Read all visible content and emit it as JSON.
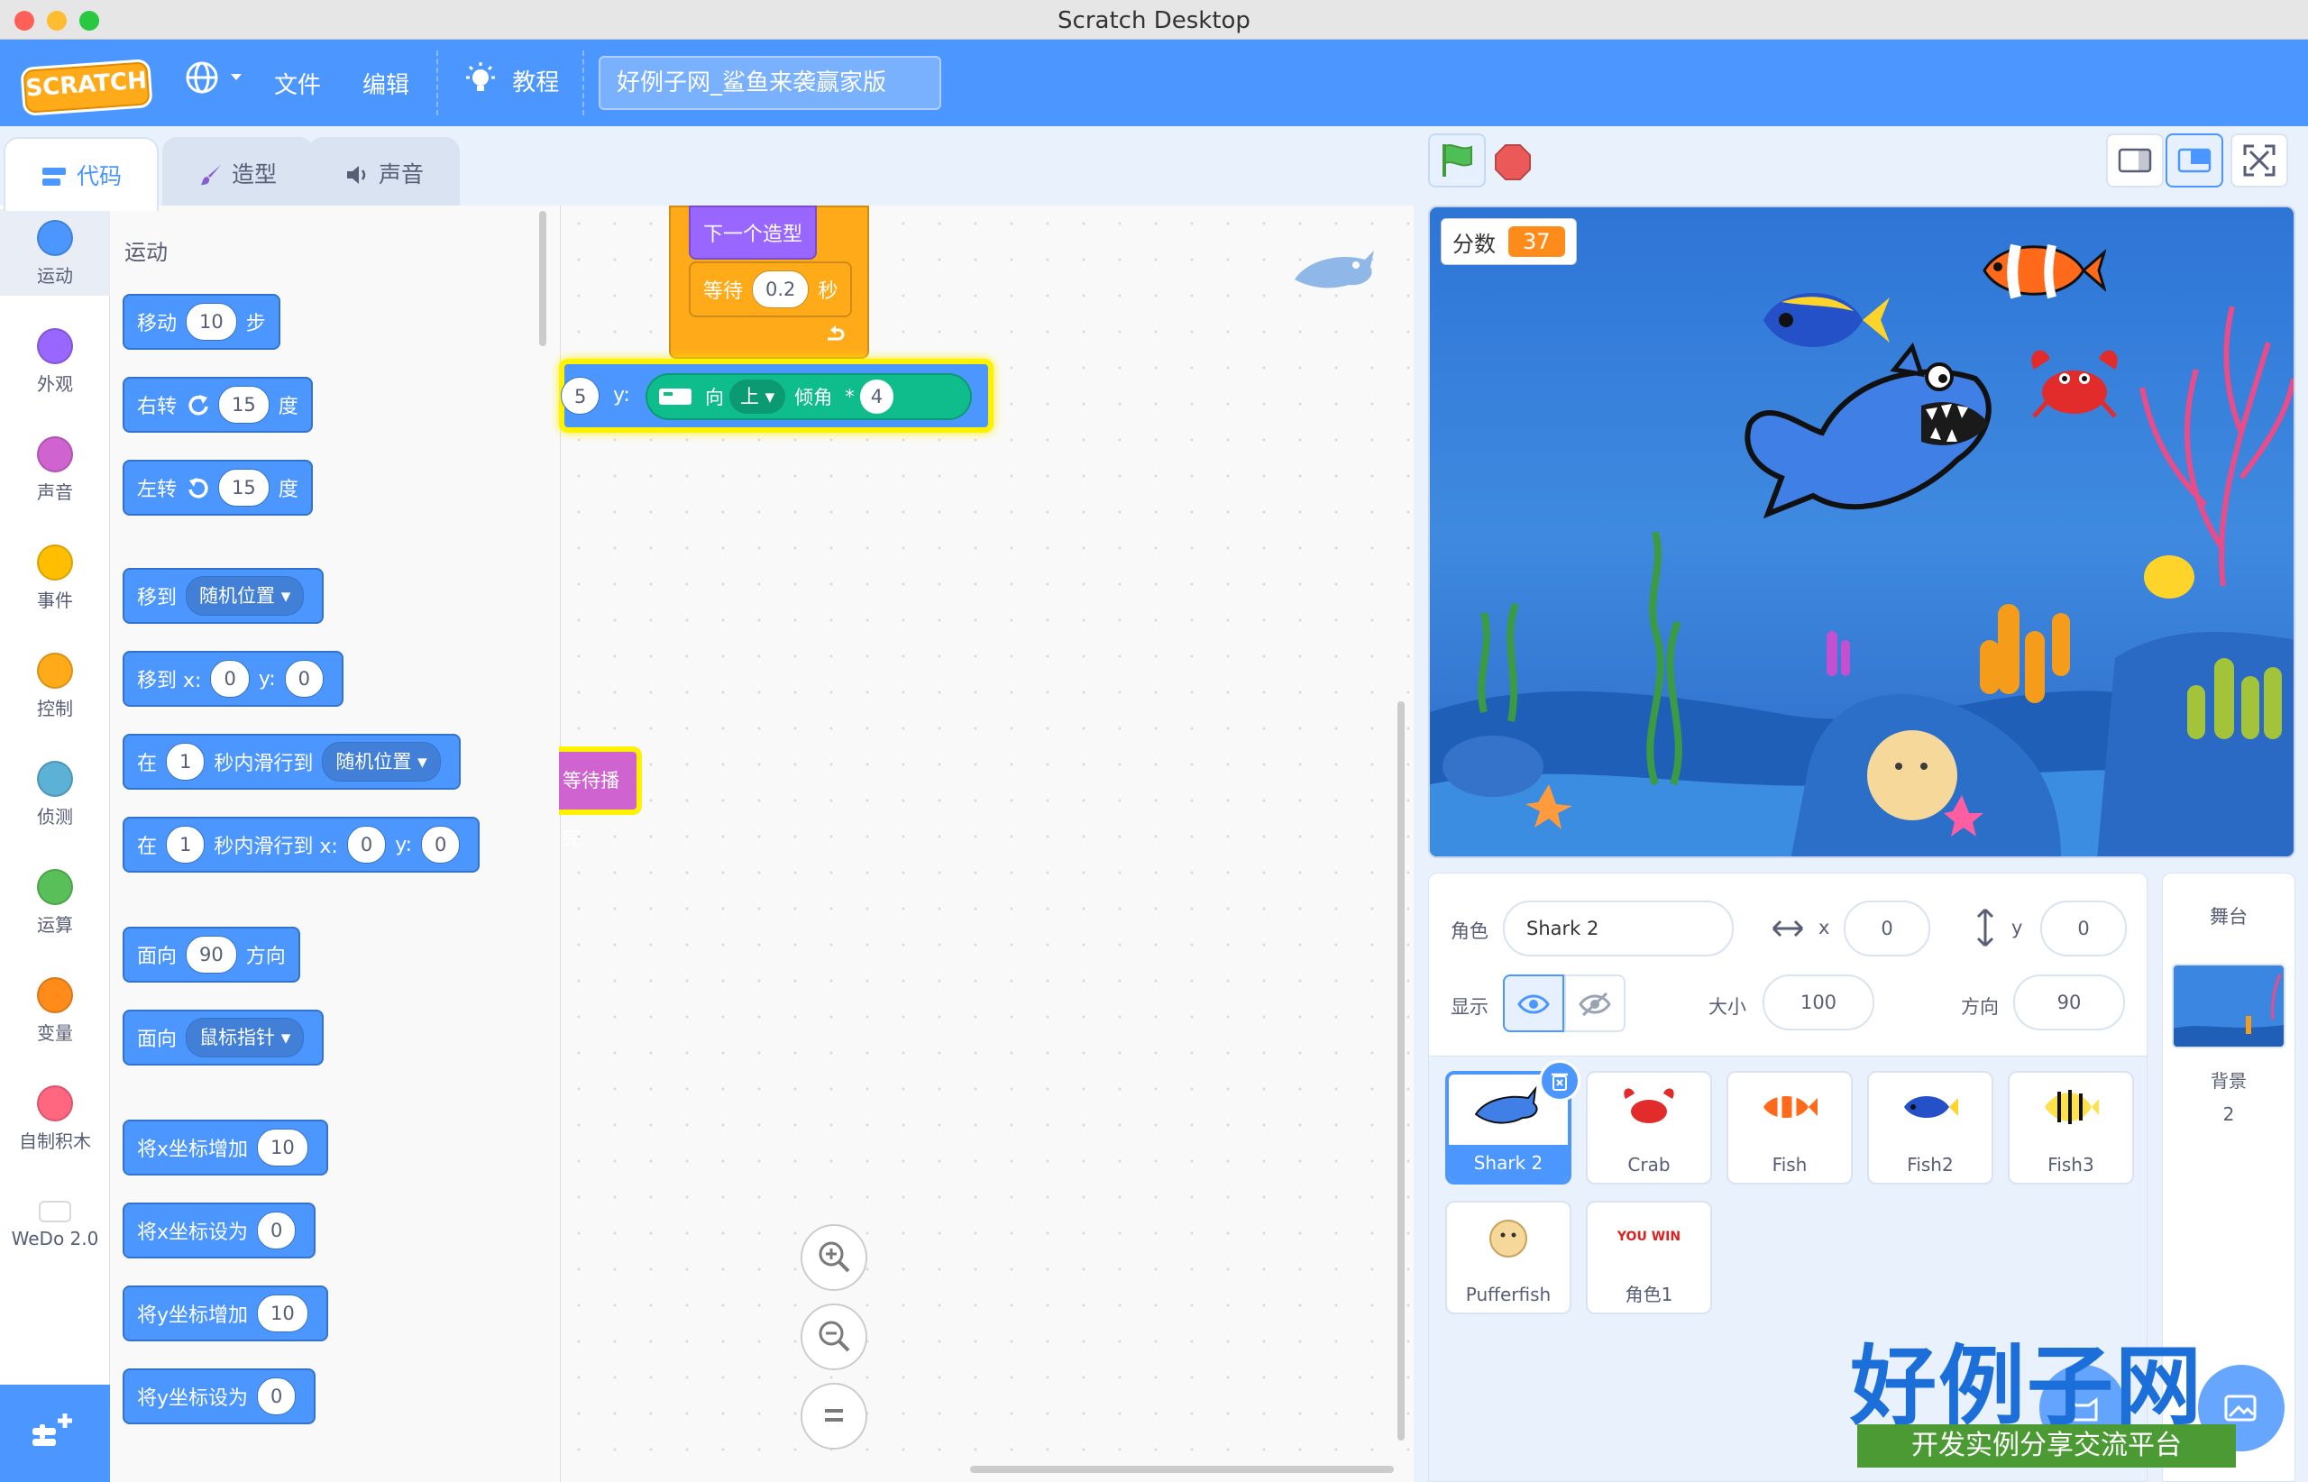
{
  "window": {
    "title": "Scratch Desktop"
  },
  "menubar": {
    "logo": "SCRATCH",
    "file": "文件",
    "edit": "编辑",
    "tutorials": "教程",
    "project_title": "好例子网_鲨鱼来袭赢家版"
  },
  "tabs": {
    "code": "代码",
    "costumes": "造型",
    "sounds": "声音"
  },
  "categories": [
    {
      "label": "运动",
      "color": "#4c97ff"
    },
    {
      "label": "外观",
      "color": "#9966ff"
    },
    {
      "label": "声音",
      "color": "#cf63cf"
    },
    {
      "label": "事件",
      "color": "#ffbf00"
    },
    {
      "label": "控制",
      "color": "#ffab19"
    },
    {
      "label": "侦测",
      "color": "#5cb1d6"
    },
    {
      "label": "运算",
      "color": "#59c059"
    },
    {
      "label": "变量",
      "color": "#ff8c1a"
    },
    {
      "label": "自制积木",
      "color": "#ff6680"
    },
    {
      "label": "WeDo 2.0",
      "color": "#ffffff"
    }
  ],
  "palette": {
    "heading": "运动",
    "move": {
      "pre": "移动",
      "val": "10",
      "post": "步"
    },
    "turn_right": {
      "pre": "右转",
      "val": "15",
      "post": "度"
    },
    "turn_left": {
      "pre": "左转",
      "val": "15",
      "post": "度"
    },
    "goto": {
      "pre": "移到",
      "dd": "随机位置"
    },
    "goto_xy": {
      "pre": "移到 x:",
      "x": "0",
      "ylab": "y:",
      "y": "0"
    },
    "glide": {
      "pre": "在",
      "val": "1",
      "mid": "秒内滑行到",
      "dd": "随机位置"
    },
    "glide_xy": {
      "pre": "在",
      "val": "1",
      "mid": "秒内滑行到 x:",
      "x": "0",
      "ylab": "y:",
      "y": "0"
    },
    "point_dir": {
      "pre": "面向",
      "val": "90",
      "post": "方向"
    },
    "point_towards": {
      "pre": "面向",
      "dd": "鼠标指针"
    },
    "change_x": {
      "pre": "将x坐标增加",
      "val": "10"
    },
    "set_x": {
      "pre": "将x坐标设为",
      "val": "0"
    },
    "change_y": {
      "pre": "将y坐标增加",
      "val": "10"
    },
    "set_y": {
      "pre": "将y坐标设为",
      "val": "0"
    }
  },
  "script": {
    "next_costume": "下一个造型",
    "wait_pre": "等待",
    "wait_val": "0.2",
    "wait_post": "秒",
    "x_val": "5",
    "y_label": "y:",
    "tilt_dir_label": "向",
    "tilt_dd": "上",
    "tilt_label": "倾角",
    "mult": "*",
    "mult_val": "4",
    "sound_wait": "等待播完"
  },
  "stage": {
    "score_label": "分数",
    "score_value": "37"
  },
  "sprite_info": {
    "sprite_label": "角色",
    "sprite_name": "Shark 2",
    "x_label": "x",
    "x": "0",
    "y_label": "y",
    "y": "0",
    "show_label": "显示",
    "size_label": "大小",
    "size": "100",
    "direction_label": "方向",
    "direction": "90"
  },
  "sprites": [
    {
      "name": "Shark 2"
    },
    {
      "name": "Crab"
    },
    {
      "name": "Fish"
    },
    {
      "name": "Fish2"
    },
    {
      "name": "Fish3"
    },
    {
      "name": "Pufferfish"
    },
    {
      "name": "角色1",
      "thumb_text": "YOU WIN"
    }
  ],
  "stage_panel": {
    "title": "舞台",
    "backdrop_label": "背景",
    "backdrop_count": "2"
  },
  "watermark": {
    "title": "好例子网",
    "subtitle": "开发实例分享交流平台"
  }
}
